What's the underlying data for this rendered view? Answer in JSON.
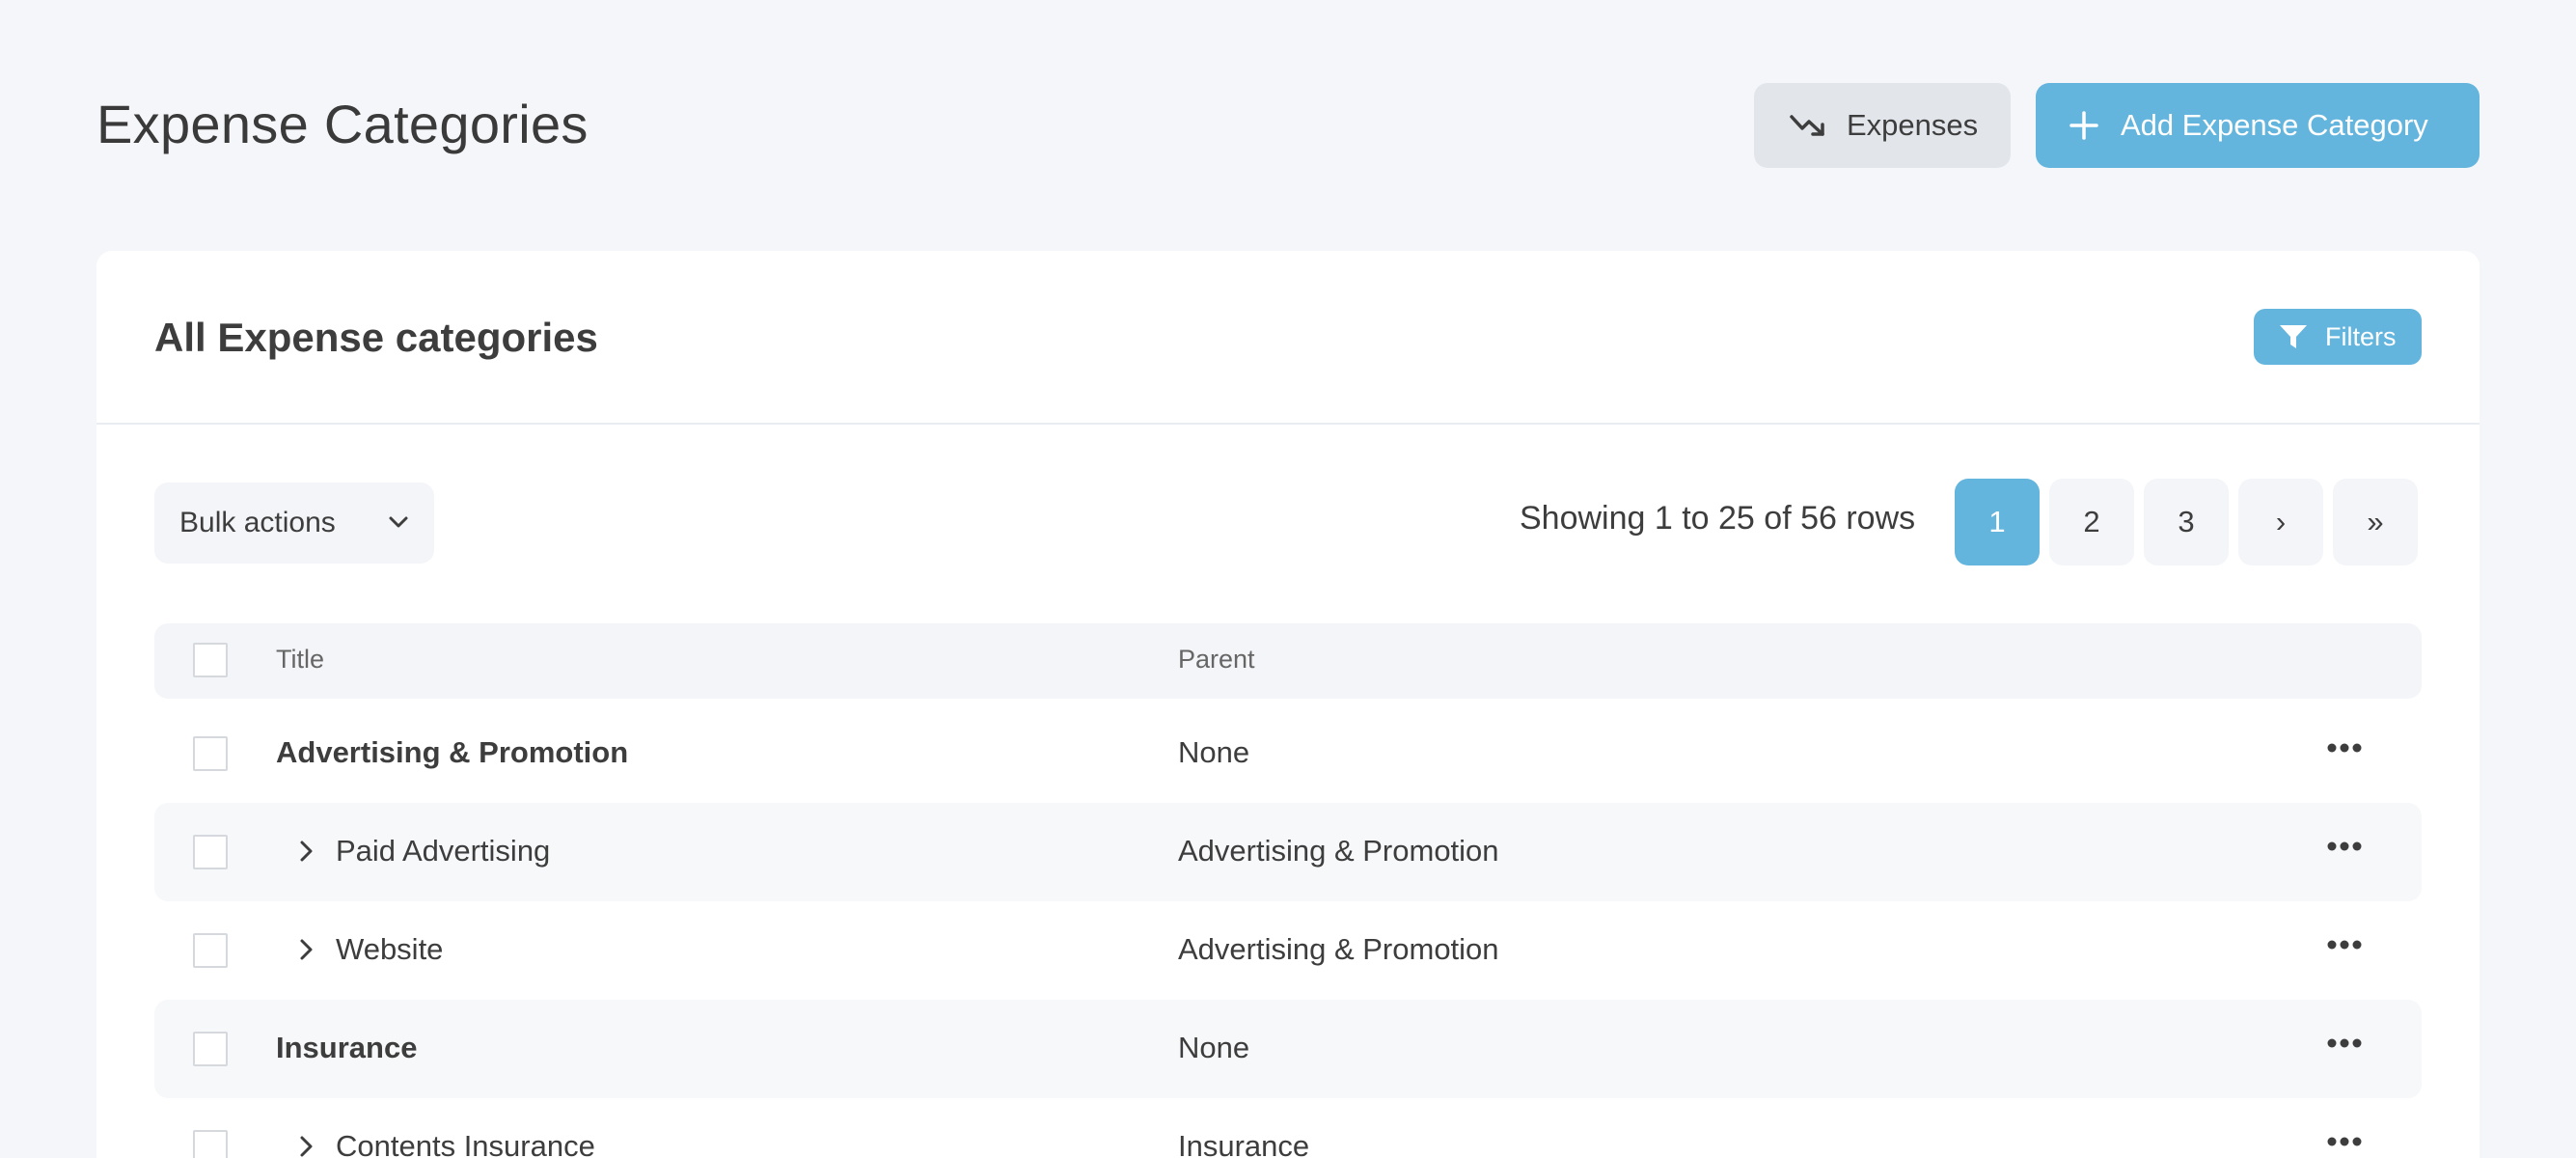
{
  "header": {
    "title": "Expense Categories",
    "expenses_button": "Expenses",
    "add_button": "Add Expense Category"
  },
  "card": {
    "title": "All Expense categories",
    "filters_button": "Filters"
  },
  "toolbar": {
    "bulk_actions": "Bulk actions",
    "showing_text": "Showing 1 to 25 of 56 rows",
    "pages": [
      "1",
      "2",
      "3",
      "›",
      "»"
    ],
    "active_page": "1"
  },
  "table": {
    "columns": [
      "Title",
      "Parent"
    ],
    "rows": [
      {
        "title": "Advertising & Promotion",
        "parent": "None"
      },
      {
        "title": "Paid Advertising",
        "parent": "Advertising & Promotion"
      },
      {
        "title": "Website",
        "parent": "Advertising & Promotion"
      },
      {
        "title": "Insurance",
        "parent": "None"
      },
      {
        "title": "Contents Insurance",
        "parent": "Insurance"
      }
    ]
  },
  "colors": {
    "accent": "#64b5dd",
    "background": "#f5f6f9",
    "secondary_button": "#e2e6eb"
  },
  "icons": [
    "trending-down-icon",
    "plus-icon",
    "filter-icon",
    "chevron-down-icon",
    "chevron-right-icon",
    "more-horizontal-icon"
  ]
}
